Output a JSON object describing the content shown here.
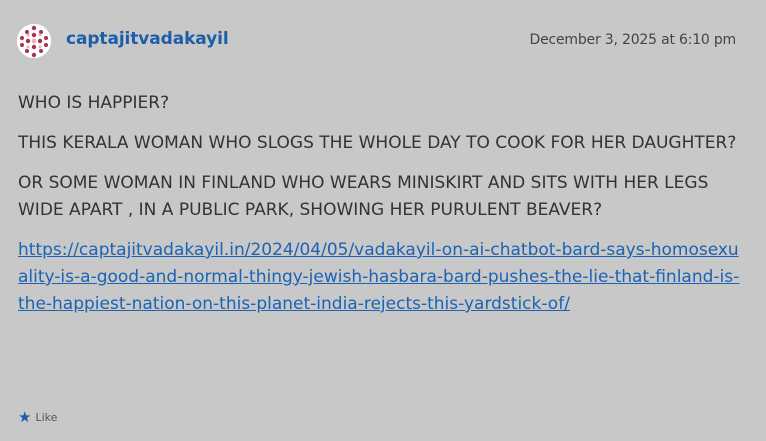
{
  "comment": {
    "author": "captajitvadakayil",
    "date": "December 3, 2025 at 6:10 pm",
    "paragraphs": [
      "WHO IS HAPPIER?",
      "THIS KERALA WOMAN WHO SLOGS THE WHOLE DAY TO COOK FOR HER DAUGHTER?",
      "OR SOME WOMAN IN FINLAND WHO WEARS MINISKIRT AND SITS WITH HER LEGS WIDE APART , IN A PUBLIC PARK, SHOWING HER PURULENT BEAVER?"
    ],
    "link": "https://captajitvadakayil.in/2024/04/05/vadakayil-on-ai-chatbot-bard-says-homosexuality-is-a-good-and-normal-thingy-jewish-hasbara-bard-pushes-the-lie-that-finland-is-the-happiest-nation-on-this-planet-india-rejects-this-yardstick-of/",
    "like_label": "Like",
    "like_icon": "star-icon"
  },
  "colors": {
    "background": "#c8c8c8",
    "author": "#1c5fa8",
    "link": "#1a63b5",
    "text": "#333333"
  }
}
